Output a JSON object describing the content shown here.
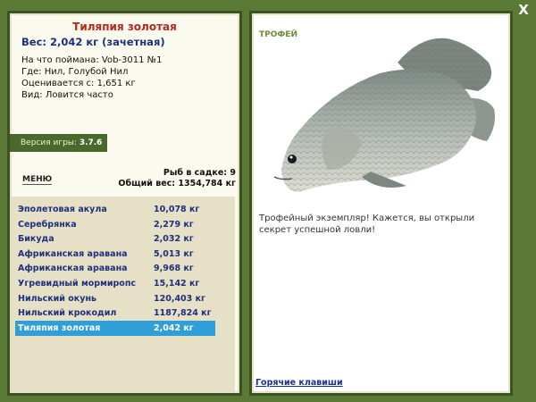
{
  "close_label": "X",
  "fish": {
    "title": "Тиляпия золотая",
    "weight_line": "Вес: 2,042 кг (зачетная)",
    "bait": "На что поймана: Vob-3011 №1",
    "place": "Где: Нил, Голубой Нил",
    "value": "Оценивается с: 1,651 кг",
    "kind": "Вид: Ловится часто"
  },
  "version": {
    "label": "Версия игры:",
    "value": "3.7.6"
  },
  "menu_label": "МЕНЮ",
  "keep": {
    "fish_count": "Рыб в садке: 9",
    "total_weight": "Общий вес: 1354,784 кг"
  },
  "catch_list": [
    {
      "name": "Эполетовая акула",
      "weight": "10,078 кг",
      "selected": false
    },
    {
      "name": "Серебрянка",
      "weight": "2,279 кг",
      "selected": false
    },
    {
      "name": "Бикуда",
      "weight": "2,032 кг",
      "selected": false
    },
    {
      "name": "Африканская аравана",
      "weight": "5,013 кг",
      "selected": false
    },
    {
      "name": "Африканская аравана",
      "weight": "9,968 кг",
      "selected": false
    },
    {
      "name": "Угревидный мормиропс",
      "weight": "15,142 кг",
      "selected": false
    },
    {
      "name": "Нильский окунь",
      "weight": "120,403 кг",
      "selected": false
    },
    {
      "name": "Нильский крокодил",
      "weight": "1187,824 кг",
      "selected": false
    },
    {
      "name": "Тиляпия золотая",
      "weight": "2,042 кг",
      "selected": true
    }
  ],
  "trophy": {
    "label": "ТРОФЕЙ",
    "text": "Трофейный экземпляр! Кажется, вы открыли секрет успешной ловли!"
  },
  "hotkeys_label": "Горячие клавиши",
  "colors": {
    "frame": "#5a7a36",
    "accent_red": "#b8281e",
    "accent_blue": "#1f2f7a",
    "selection": "#2f9ed9"
  }
}
